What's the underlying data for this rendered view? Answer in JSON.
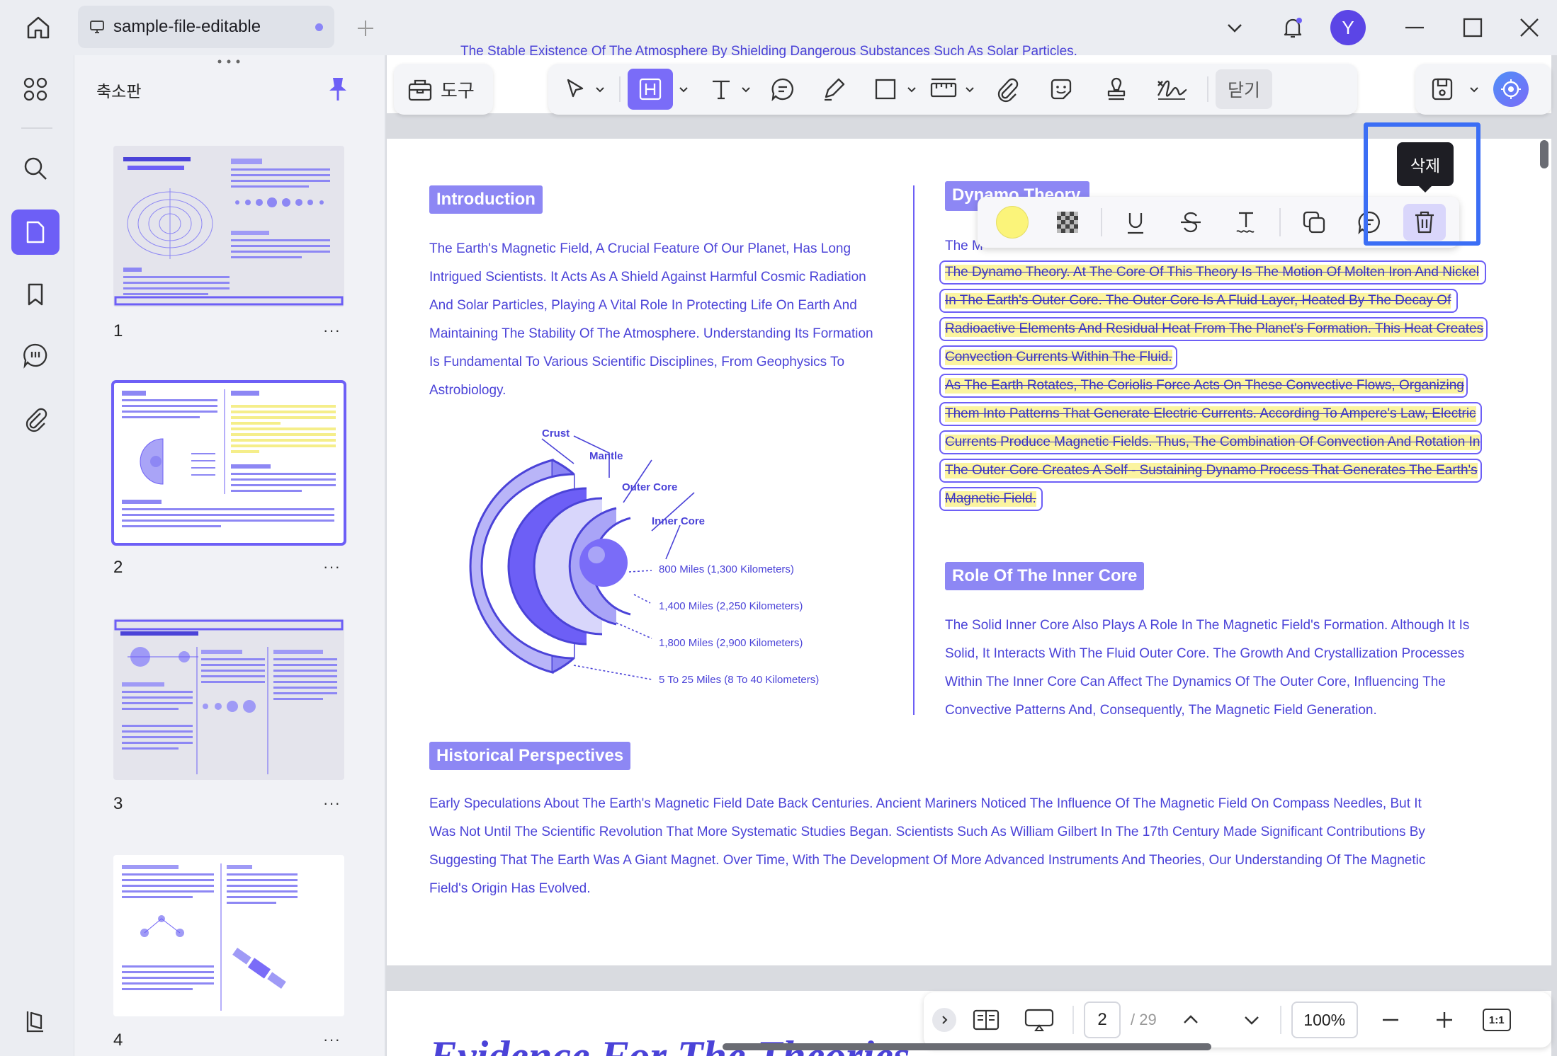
{
  "window": {
    "tab_title": "sample-file-editable",
    "avatar_letter": "Y"
  },
  "sidebar": {
    "panel_title": "축소판",
    "pages": [
      {
        "num": "1",
        "more": "···"
      },
      {
        "num": "2",
        "more": "···"
      },
      {
        "num": "3",
        "more": "···"
      },
      {
        "num": "4",
        "more": "···"
      }
    ]
  },
  "toolbar": {
    "tools_label": "도구",
    "close_label": "닫기",
    "active_tool": "highlight"
  },
  "page": {
    "top_fragment": "The Stable Existence Of The Atmosphere By Shielding Dangerous Substances Such As Solar Particles.",
    "intro": {
      "heading": "Introduction",
      "lines": [
        "The Earth's Magnetic Field, A Crucial Feature Of Our Planet, Has Long",
        "Intrigued Scientists. It Acts As A Shield Against Harmful Cosmic Radiation",
        "And Solar Particles, Playing A Vital Role In Protecting Life On Earth And",
        "Maintaining The Stability Of The Atmosphere. Understanding Its Formation",
        "Is Fundamental To Various Scientific Disciplines, From Geophysics To",
        "Astrobiology."
      ]
    },
    "diagram": {
      "labels": [
        "Crust",
        "Mantle",
        "Outer Core",
        "Inner Core"
      ],
      "distances": [
        "800 Miles (1,300 Kilometers)",
        "1,400 Miles (2,250 Kilometers)",
        "1,800 Miles (2,900 Kilometers)",
        "5 To 25 Miles (8 To 40 Kilometers)"
      ]
    },
    "dynamo": {
      "heading": "Dynamo Theory",
      "first_line": "The M",
      "highlighted_lines": [
        "The Dynamo Theory. At The Core Of This Theory Is The Motion Of Molten Iron And Nickel",
        "In The Earth's Outer Core. The Outer Core Is A Fluid Layer, Heated By The Decay Of",
        "Radioactive Elements And Residual Heat From The Planet's Formation. This Heat Creates",
        "Convection Currents Within The Fluid.",
        "As The Earth Rotates, The Coriolis Force Acts On These Convective Flows, Organizing",
        "Them Into Patterns That Generate Electric Currents. According To Ampere's Law, Electric",
        "Currents Produce Magnetic Fields. Thus, The Combination Of Convection And Rotation In",
        "The Outer Core Creates A Self - Sustaining Dynamo Process That Generates The Earth's",
        "Magnetic Field."
      ]
    },
    "inner_core": {
      "heading": "Role Of The Inner Core",
      "lines": [
        "The Solid Inner Core Also Plays A Role In The Magnetic Field's Formation. Although It Is",
        "Solid, It Interacts With The Fluid Outer Core. The Growth And Crystallization Processes",
        "Within The Inner Core Can Affect The Dynamics Of The Outer Core, Influencing The",
        "Convective Patterns And, Consequently, The Magnetic Field Generation."
      ]
    },
    "historical": {
      "heading": "Historical Perspectives",
      "lines": [
        "Early Speculations About The Earth's Magnetic Field Date Back Centuries. Ancient Mariners Noticed The Influence Of The Magnetic Field On Compass Needles, But It",
        "Was Not Until The Scientific Revolution That More Systematic Studies Began. Scientists Such As William Gilbert In The 17th Century Made Significant Contributions By",
        "Suggesting That The Earth Was A Giant Magnet. Over Time, With The Development Of More Advanced Instruments And Theories, Our Understanding Of The Magnetic",
        "Field's Origin Has Evolved."
      ]
    },
    "next_page_title": "Evidence For The Theories"
  },
  "annotation_toolbar": {
    "highlight_color": "#fbf47a",
    "tooltip": "삭제"
  },
  "bottom_bar": {
    "current_page": "2",
    "total_pages": "/ 29",
    "zoom": "100%",
    "fit_label": "1:1"
  },
  "colors": {
    "accent": "#6d5ff6",
    "heading_bg": "#8d87f4",
    "text": "#4b43d8",
    "focus_border": "#3b6ef5"
  }
}
